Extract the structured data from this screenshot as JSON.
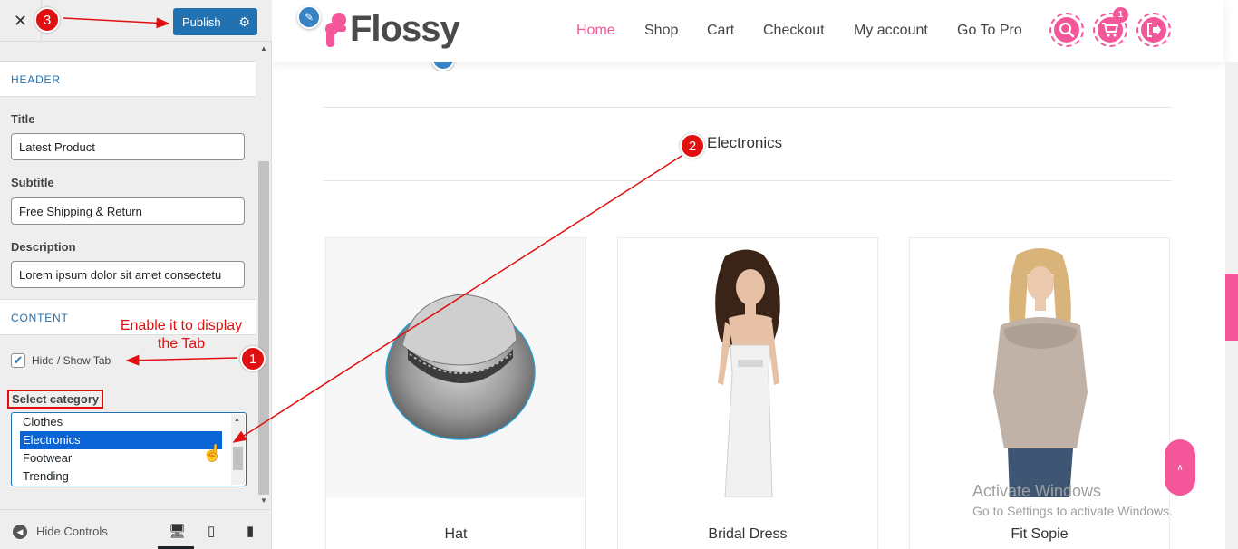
{
  "customizer": {
    "close_label": "✕",
    "publish_label": "Publish",
    "sections": {
      "header": "HEADER",
      "content": "CONTENT"
    },
    "fields": {
      "title_label": "Title",
      "title_value": "Latest Product",
      "subtitle_label": "Subtitle",
      "subtitle_value": "Free Shipping & Return",
      "description_label": "Description",
      "description_value": "Lorem ipsum dolor sit amet consectetu",
      "hide_show_tab_label": "Hide / Show Tab",
      "hide_show_tab_checked": true,
      "select_category_label": "Select category"
    },
    "category_options": [
      "Clothes",
      "Electronics",
      "Footwear",
      "Trending"
    ],
    "selected_category": "Electronics",
    "footer": {
      "hide_controls_label": "Hide Controls",
      "devices": [
        "desktop",
        "tablet",
        "mobile"
      ]
    }
  },
  "annotations": {
    "step1": "1",
    "step2": "2",
    "step3": "3",
    "note": "Enable it to display the Tab",
    "color": "#e01010"
  },
  "site": {
    "logo_text": "Flossy",
    "nav": [
      "Home",
      "Shop",
      "Cart",
      "Checkout",
      "My account",
      "Go To Pro"
    ],
    "active_nav": "Home",
    "cart_count": "1",
    "accent": "#f3579a",
    "tab_title": "Electronics",
    "products": [
      {
        "name": "Hat",
        "image": "hat"
      },
      {
        "name": "Bridal Dress",
        "image": "woman-in-white-dress"
      },
      {
        "name": "Fit Sopie",
        "image": "woman-in-sweater"
      }
    ],
    "back_to_top": "∧"
  },
  "watermark": {
    "line1": "Activate Windows",
    "line2": "Go to Settings to activate Windows."
  }
}
